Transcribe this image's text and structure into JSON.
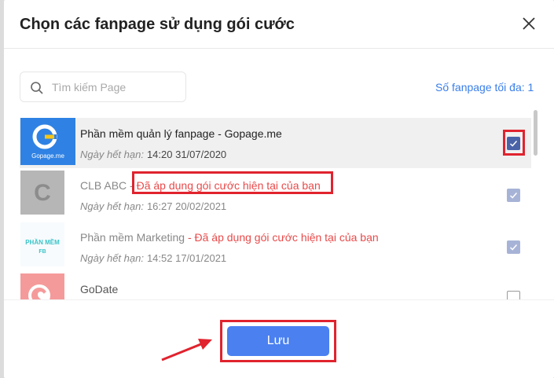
{
  "modal": {
    "title": "Chọn các fanpage sử dụng gói cước"
  },
  "search": {
    "placeholder": "Tìm kiếm Page",
    "value": ""
  },
  "max_count": "Số fanpage tối đa: 1",
  "expiry_label": "Ngày hết hạn:",
  "pages": [
    {
      "name": "Phần mềm quản lý fanpage - Gopage.me",
      "status": "",
      "expiry": "14:20 31/07/2020",
      "checked": true,
      "disabled": false,
      "avatar_text": "Gopage.me"
    },
    {
      "name": "CLB ABC",
      "status": "Đã áp dụng gói cước hiện tại của bạn",
      "expiry": "16:27 20/02/2021",
      "checked": true,
      "disabled": true,
      "avatar_text": "C"
    },
    {
      "name": "Phần mềm Marketing",
      "status": "Đã áp dụng gói cước hiện tại của bạn",
      "expiry": "14:52 17/01/2021",
      "checked": true,
      "disabled": true,
      "avatar_text": "PHẦN MỀM FB"
    },
    {
      "name": "GoDate",
      "status": "",
      "expiry": "",
      "checked": false,
      "disabled": false,
      "avatar_text": ""
    }
  ],
  "save_label": "Lưu",
  "colors": {
    "accent": "#4a80f0",
    "warning": "#e84a4a",
    "highlight": "#e0232e",
    "link": "#3a7ee8"
  }
}
